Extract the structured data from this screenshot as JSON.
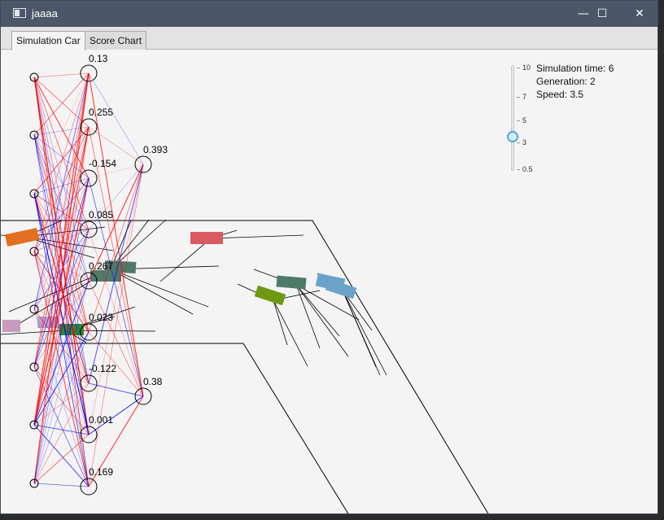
{
  "window": {
    "title": "jaaaa",
    "buttons": {
      "minimize": "—",
      "maximize": "☐",
      "close": "✕"
    }
  },
  "tabs": [
    {
      "label": "Simulation Car",
      "active": true
    },
    {
      "label": "Score Chart",
      "active": false
    }
  ],
  "info": {
    "time": "Simulation time: 6",
    "generation": "Generation: 2",
    "speed": "Speed: 3.5"
  },
  "speed_slider": {
    "value": 3.5,
    "min": 0.5,
    "max": 10,
    "ticks": [
      "10",
      "7",
      "5",
      "3",
      "0.5"
    ]
  },
  "network": {
    "hidden_values": [
      "0.13",
      "0.255",
      "-0.154",
      "0.085",
      "0.267",
      "0.023",
      "-0.122",
      "0.001",
      "0.169"
    ],
    "output_values": [
      "0.393",
      "0.38"
    ],
    "colors": {
      "positive": "#0000ff",
      "negative": "#ff0000"
    }
  },
  "cars": [
    {
      "color": "#d95a60"
    },
    {
      "color": "#4f7a6a"
    },
    {
      "color": "#6e9a12"
    },
    {
      "color": "#6aa3c7"
    },
    {
      "color": "#e07020"
    },
    {
      "color": "#c99ac0"
    }
  ]
}
